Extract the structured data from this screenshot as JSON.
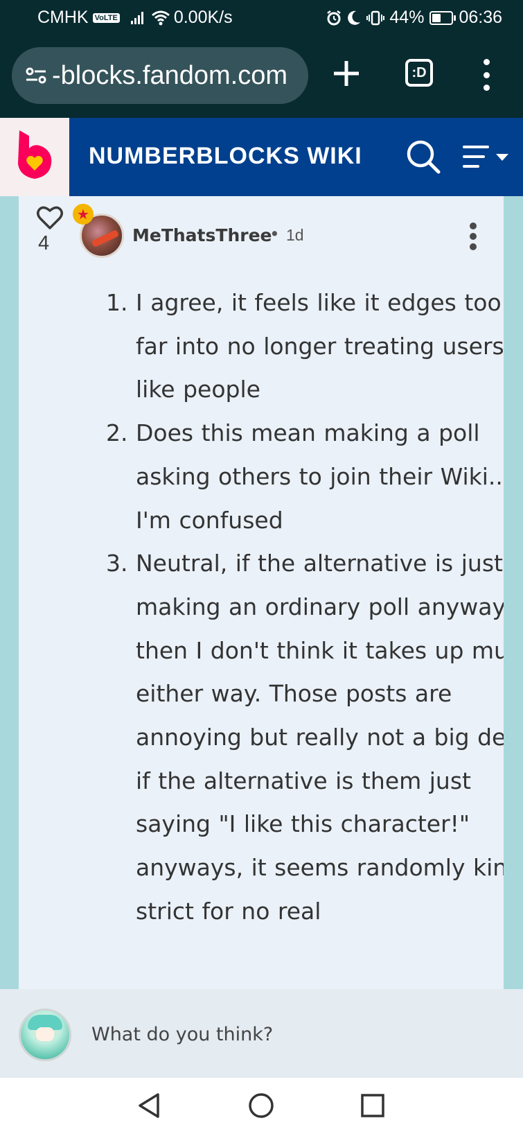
{
  "status_bar": {
    "carrier": "CMHK",
    "volte": "VoLTE",
    "net_speed": "0.00K/s",
    "battery": "44%",
    "time": "06:36"
  },
  "browser": {
    "url": "-blocks.fandom.com"
  },
  "wiki": {
    "title": "NUMBERBLOCKS WIKI",
    "brand_color": "#00408e"
  },
  "comment": {
    "likes": "4",
    "author": "MeThatsThree",
    "separator": "•",
    "timestamp": "1d",
    "items": [
      "I agree, it feels like it edges too far into no longer treating users like people",
      "Does this mean making a poll asking others to join their Wiki..?  I'm confused",
      "Neutral, if the alternative is just making an ordinary poll anyways, then I don't think it takes up much either way. Those posts are annoying but really not a big deal if the alternative is them just saying \"I like this character!\" anyways, it seems randomly kinda strict for no real"
    ]
  },
  "reply": {
    "placeholder": "What do you think?"
  },
  "icons": {
    "status": [
      "signal-icon",
      "wifi-icon",
      "alarm-icon",
      "moon-icon",
      "vibrate-icon",
      "battery-icon"
    ],
    "browser": [
      "site-settings-icon",
      "plus-icon",
      "tabs-icon",
      "more-vert-icon"
    ],
    "wiki": [
      "fandom-logo-icon",
      "search-icon",
      "menu-icon"
    ],
    "comment": [
      "heart-icon",
      "star-badge-icon",
      "more-vert-icon"
    ],
    "nav": [
      "back-icon",
      "home-icon",
      "recents-icon"
    ]
  }
}
